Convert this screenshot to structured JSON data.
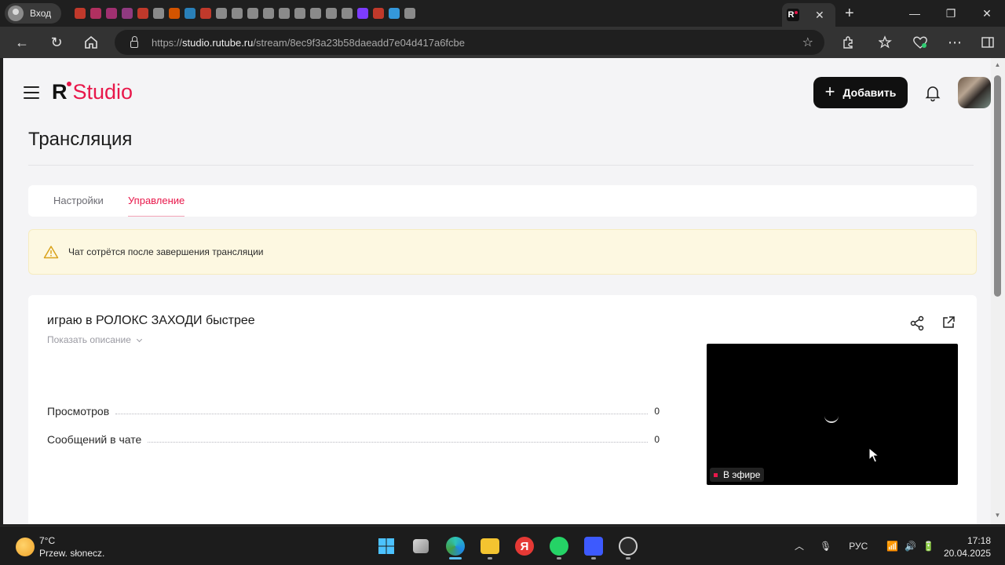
{
  "browser": {
    "profile_label": "Вход",
    "url_prefix": "https://",
    "url_domain": "studio.rutube.ru",
    "url_path": "/stream/8ec9f3a23b58daeadd7e04d417a6fcbe",
    "active_tab_favicon": "R",
    "tab_colors": [
      "#c0392b",
      "#b03060",
      "#a03070",
      "#903a80",
      "#c0392b",
      "#8a8a8a",
      "#d35400",
      "#2980b9",
      "#c0392b",
      "#8a8a8a",
      "#8a8a8a",
      "#8a8a8a",
      "#8a8a8a",
      "#8a8a8a",
      "#8a8a8a",
      "#8a8a8a",
      "#8a8a8a",
      "#8a8a8a",
      "#7d3cff",
      "#c0392b",
      "#3498db",
      "#8a8a8a"
    ]
  },
  "header": {
    "logo_r": "R",
    "logo_studio": "Studio",
    "add_button_label": "Добавить"
  },
  "page": {
    "title": "Трансляция",
    "tabs": [
      {
        "label": "Настройки",
        "active": false
      },
      {
        "label": "Управление",
        "active": true
      }
    ],
    "alert_text": "Чат сотрётся после завершения трансляции"
  },
  "stream": {
    "title": "играю в РОЛОКС ЗАХОДИ быстрее",
    "show_description_label": "Показать описание",
    "stats": [
      {
        "label": "Просмотров",
        "value": "0"
      },
      {
        "label": "Сообщений в чате",
        "value": "0"
      }
    ],
    "live_badge_label": "В эфире"
  },
  "taskbar": {
    "weather_temp": "7°C",
    "weather_desc": "Przew. słonecz.",
    "language": "РУС",
    "time": "17:18",
    "date": "20.04.2025"
  },
  "colors": {
    "accent": "#e8174a",
    "help_fab": "#1c8fa0"
  }
}
